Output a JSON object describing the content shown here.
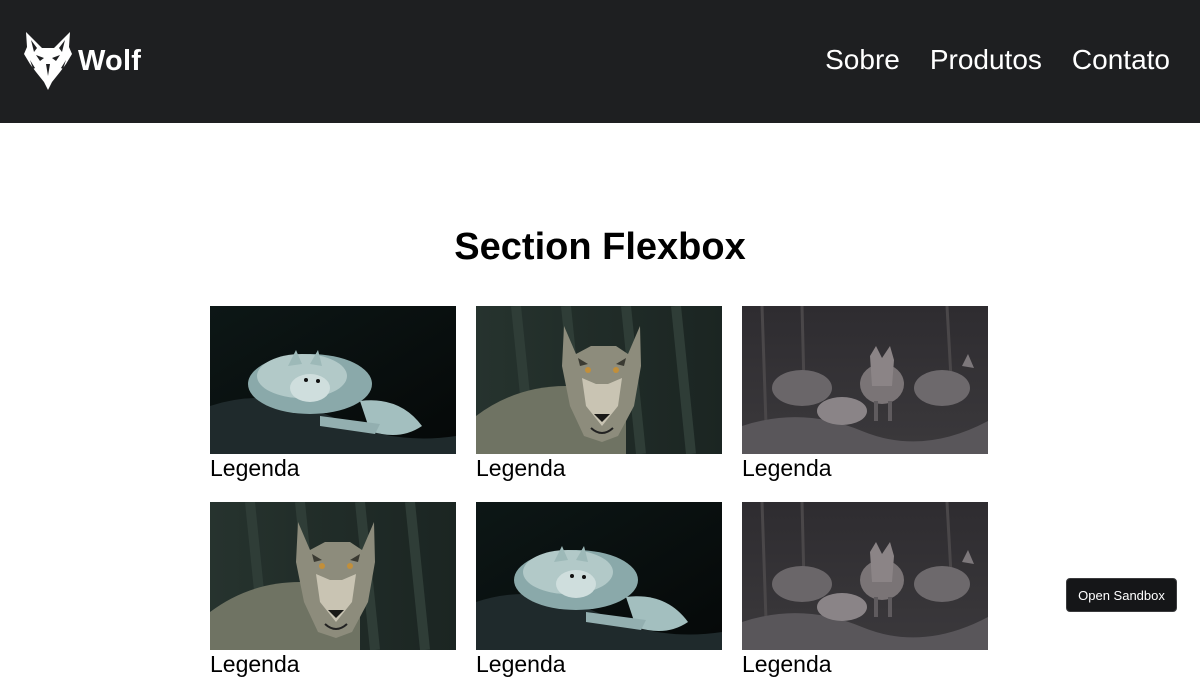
{
  "header": {
    "logo_text": "Wolf",
    "nav": [
      {
        "label": "Sobre"
      },
      {
        "label": "Produtos"
      },
      {
        "label": "Contato"
      }
    ]
  },
  "main": {
    "title": "Section Flexbox",
    "cards": [
      {
        "caption": "Legenda",
        "image": "white-wolf-lying"
      },
      {
        "caption": "Legenda",
        "image": "gray-wolf-portrait"
      },
      {
        "caption": "Legenda",
        "image": "wolf-pack-forest"
      },
      {
        "caption": "Legenda",
        "image": "gray-wolf-portrait"
      },
      {
        "caption": "Legenda",
        "image": "white-wolf-lying"
      },
      {
        "caption": "Legenda",
        "image": "wolf-pack-forest"
      }
    ]
  },
  "sandbox_button": {
    "label": "Open Sandbox"
  },
  "colors": {
    "header_bg": "#1e1f21",
    "page_bg": "#ffffff",
    "text": "#000000",
    "button_bg": "#151618"
  }
}
